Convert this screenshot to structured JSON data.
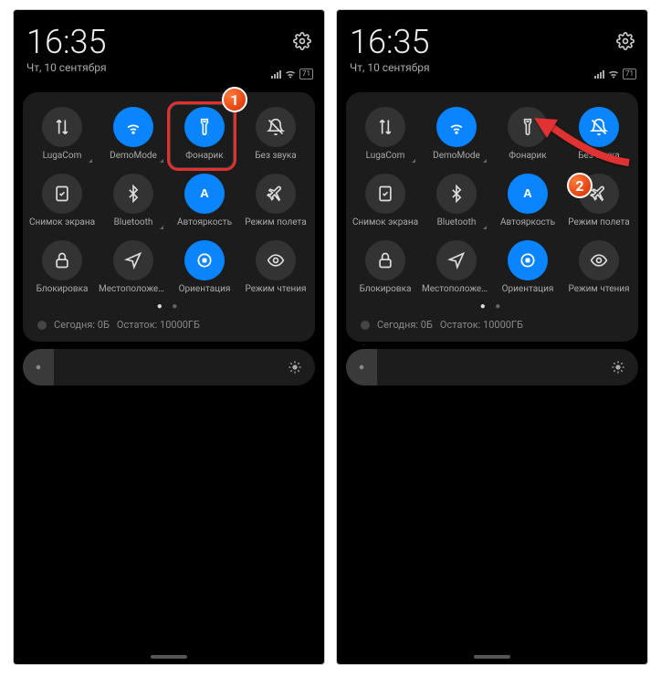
{
  "time": "16:35",
  "date": "Чт, 10 сентября",
  "battery": "71",
  "tiles": [
    {
      "label": "LugaCom",
      "icon": "data-arrows",
      "on": false,
      "expand": true
    },
    {
      "label": "DemoMode",
      "icon": "wifi",
      "on": true,
      "expand": true
    },
    {
      "label": "Фонарик",
      "icon": "flashlight",
      "on": true,
      "expand": false
    },
    {
      "label": "Без звука",
      "icon": "bell-off",
      "on": false,
      "expand": false
    },
    {
      "label": "Снимок экрана",
      "icon": "screenshot",
      "on": false,
      "expand": false
    },
    {
      "label": "Bluetooth",
      "icon": "bluetooth",
      "on": false,
      "expand": true
    },
    {
      "label": "Автояркость",
      "icon": "letter-a",
      "on": true,
      "expand": false
    },
    {
      "label": "Режим полета",
      "icon": "airplane",
      "on": false,
      "expand": false
    },
    {
      "label": "Блокировка",
      "icon": "lock",
      "on": false,
      "expand": false
    },
    {
      "label": "Местоположение",
      "icon": "location",
      "on": false,
      "expand": false
    },
    {
      "label": "Ориентация",
      "icon": "orientation",
      "on": true,
      "expand": false
    },
    {
      "label": "Режим чтения",
      "icon": "eye",
      "on": false,
      "expand": false
    }
  ],
  "tiles_right": [
    {
      "label": "LugaCom",
      "icon": "data-arrows",
      "on": false,
      "expand": true
    },
    {
      "label": "DemoMode",
      "icon": "wifi",
      "on": true,
      "expand": true
    },
    {
      "label": "Фонарик",
      "icon": "flashlight",
      "on": false,
      "expand": false
    },
    {
      "label": "Без звука",
      "icon": "bell-off",
      "on": true,
      "expand": false
    },
    {
      "label": "Снимок экрана",
      "icon": "screenshot",
      "on": false,
      "expand": false
    },
    {
      "label": "Bluetooth",
      "icon": "bluetooth",
      "on": false,
      "expand": true
    },
    {
      "label": "Автояркость",
      "icon": "letter-a",
      "on": true,
      "expand": false
    },
    {
      "label": "Режим полета",
      "icon": "airplane",
      "on": false,
      "expand": false
    },
    {
      "label": "Блокировка",
      "icon": "lock",
      "on": false,
      "expand": false
    },
    {
      "label": "Местоположение",
      "icon": "location",
      "on": false,
      "expand": false
    },
    {
      "label": "Ориентация",
      "icon": "orientation",
      "on": true,
      "expand": false
    },
    {
      "label": "Режим чтения",
      "icon": "eye",
      "on": false,
      "expand": false
    }
  ],
  "data_today": "Сегодня: 0Б",
  "data_remaining": "Остаток: 10000ГБ",
  "badges": {
    "left": "1",
    "right": "2"
  }
}
